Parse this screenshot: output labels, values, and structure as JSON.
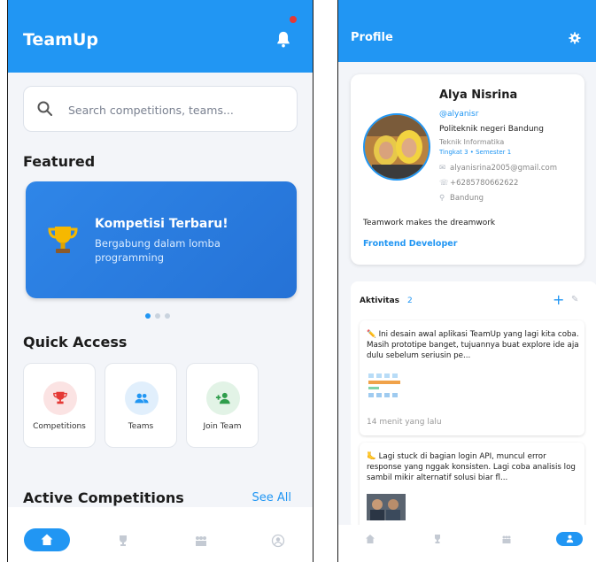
{
  "home": {
    "app_title": "TeamUp",
    "search_placeholder": "Search competitions, teams...",
    "featured_title": "Featured",
    "banner": {
      "title": "Kompetisi Terbaru!",
      "subtitle": "Bergabung dalam lomba programming"
    },
    "carousel_active_index": 0,
    "quick_access_title": "Quick Access",
    "quick_access": [
      {
        "label": "Competitions",
        "icon": "trophy-icon",
        "color": "#e53935",
        "bg": "#fbe3e3"
      },
      {
        "label": "Teams",
        "icon": "group-icon",
        "color": "#2196f3",
        "bg": "#e1effc"
      },
      {
        "label": "Join Team",
        "icon": "person-add-icon",
        "color": "#2e9d4b",
        "bg": "#e2f3e6"
      }
    ],
    "active_competitions_title": "Active Competitions",
    "see_all": "See All",
    "nav_items": [
      "home-icon",
      "trophy-icon",
      "group-icon",
      "profile-icon"
    ]
  },
  "profile": {
    "title": "Profile",
    "name": "Alya Nisrina",
    "handle": "@alyanisr",
    "school": "Politeknik negeri Bandung",
    "major": "Teknik Informatika",
    "level": "Tingkat 3 • Semester 1",
    "email": "alyanisrina2005@gmail.com",
    "phone": "+6285780662622",
    "location": "Bandung",
    "bio": "Teamwork makes the dreamwork",
    "role": "Frontend Developer",
    "activity_title": "Aktivitas",
    "activity_count": "2",
    "posts": [
      {
        "text": "✏️ Ini desain awal aplikasi TeamUp yang lagi kita coba. Masih prototipe banget, tujuannya buat explore ide aja dulu sebelum seriusin pe...",
        "time": "14 menit yang lalu"
      },
      {
        "text": "🦶 Lagi stuck di bagian login API, muncul error response yang nggak konsisten. Lagi coba analisis log sambil mikir alternatif solusi biar fl..."
      }
    ]
  },
  "colors": {
    "primary": "#2196f3",
    "notification": "#e53935"
  }
}
